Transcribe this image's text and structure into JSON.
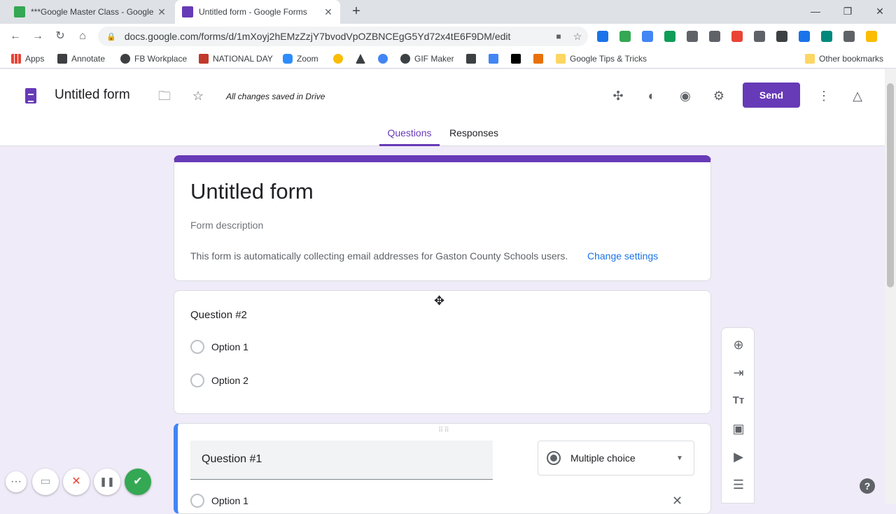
{
  "browser": {
    "tabs": [
      {
        "title": "***Google Master Class - Google",
        "close": "✕",
        "favicon_color": "#34a853"
      },
      {
        "title": "Untitled form - Google Forms",
        "close": "✕",
        "favicon_color": "#673ab7"
      }
    ],
    "new_tab": "+",
    "window_controls": {
      "minimize": "—",
      "restore": "❐",
      "close": "✕"
    },
    "nav": {
      "back": "←",
      "forward": "→",
      "reload": "↻",
      "home": "⌂"
    },
    "address": {
      "lock": "🔒",
      "url": "docs.google.com/forms/d/1mXoyj2hEMzZzjY7bvodVpOZBNCEgG5Yd72x4tE6F9DM/edit",
      "star": "☆",
      "camera": "■"
    },
    "bookmarks": [
      {
        "label": "Apps",
        "icon_color": "#ea4335"
      },
      {
        "label": "Annotate",
        "icon_color": "#3c4043"
      },
      {
        "label": "FB Workplace",
        "icon_color": "#3c4043"
      },
      {
        "label": "NATIONAL DAY",
        "icon_color": "#c0392b"
      },
      {
        "label": "Zoom",
        "icon_color": "#2d8cff"
      },
      {
        "label": "",
        "icon_color": "#fbbc04"
      },
      {
        "label": "",
        "icon_color": "#3c4043"
      },
      {
        "label": "",
        "icon_color": "#4285f4"
      },
      {
        "label": "GIF Maker",
        "icon_color": "#3c4043"
      },
      {
        "label": "",
        "icon_color": "#3c4043"
      },
      {
        "label": "",
        "icon_color": "#4285f4"
      },
      {
        "label": "",
        "icon_color": "#000000"
      },
      {
        "label": "",
        "icon_color": "#e8710a"
      },
      {
        "label": "Google Tips & Tricks",
        "icon_color": "#fdd663"
      },
      {
        "label": "Other bookmarks",
        "icon_color": "#fdd663"
      }
    ],
    "extensions": [
      "#1a73e8",
      "#34a853",
      "#4285f4",
      "#0f9d58",
      "#5f6368",
      "#5f6368",
      "#ea4335",
      "#5f6368",
      "#3c4043",
      "#1a73e8",
      "#00897b",
      "#5f6368",
      "#fbbc04"
    ]
  },
  "header": {
    "title": "Untitled form",
    "saved_status": "All changes saved in Drive",
    "send_label": "Send",
    "icons": {
      "folder": "🗀",
      "star": "☆",
      "addons": "✣",
      "palette": "◐",
      "preview": "◉",
      "settings": "⚙",
      "more": "⋮",
      "drive": "△"
    },
    "tabs": {
      "questions": "Questions",
      "responses": "Responses"
    }
  },
  "title_card": {
    "title": "Untitled form",
    "description_placeholder": "Form description",
    "notice": "This form is automatically collecting email addresses for Gaston County Schools users.",
    "change_link": "Change settings"
  },
  "question2": {
    "title": "Question #2",
    "options": [
      "Option 1",
      "Option 2"
    ]
  },
  "question1": {
    "title": "Question #1",
    "type": "Multiple choice",
    "caret": "▼",
    "drag_handle": "⠿⠿",
    "option": "Option 1",
    "remove": "✕"
  },
  "floating_toolbar": {
    "add_question": "⊕",
    "import_questions": "⇥",
    "add_title": "Tт",
    "add_image": "▣",
    "add_video": "▶",
    "add_section": "☰"
  },
  "help": "?",
  "cursor": "✥",
  "recorder": {
    "more": "···",
    "camera": "▭",
    "cancel": "✕",
    "pause": "❚❚",
    "done": "✔"
  }
}
